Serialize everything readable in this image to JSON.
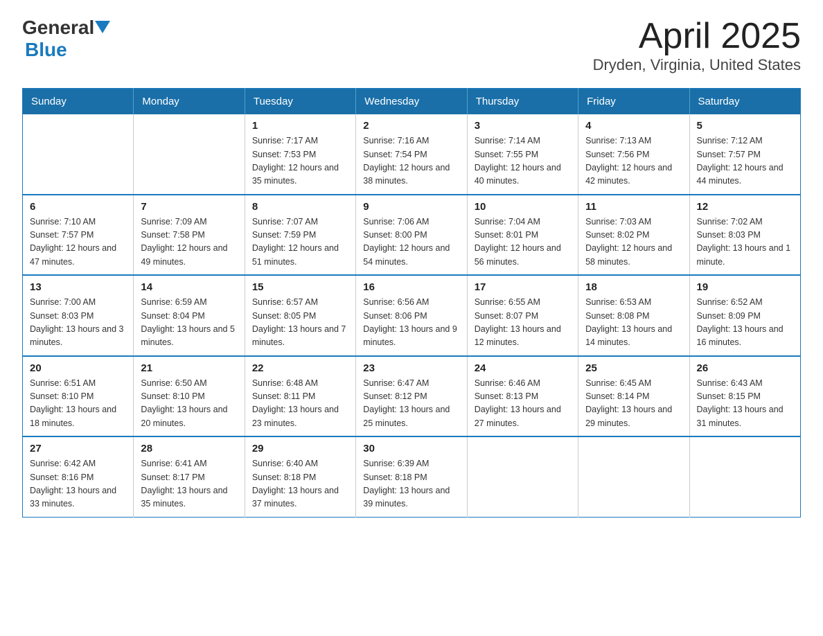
{
  "header": {
    "logo_general": "General",
    "logo_blue": "Blue",
    "title": "April 2025",
    "subtitle": "Dryden, Virginia, United States"
  },
  "weekdays": [
    "Sunday",
    "Monday",
    "Tuesday",
    "Wednesday",
    "Thursday",
    "Friday",
    "Saturday"
  ],
  "weeks": [
    [
      {
        "day": "",
        "sunrise": "",
        "sunset": "",
        "daylight": ""
      },
      {
        "day": "",
        "sunrise": "",
        "sunset": "",
        "daylight": ""
      },
      {
        "day": "1",
        "sunrise": "Sunrise: 7:17 AM",
        "sunset": "Sunset: 7:53 PM",
        "daylight": "Daylight: 12 hours and 35 minutes."
      },
      {
        "day": "2",
        "sunrise": "Sunrise: 7:16 AM",
        "sunset": "Sunset: 7:54 PM",
        "daylight": "Daylight: 12 hours and 38 minutes."
      },
      {
        "day": "3",
        "sunrise": "Sunrise: 7:14 AM",
        "sunset": "Sunset: 7:55 PM",
        "daylight": "Daylight: 12 hours and 40 minutes."
      },
      {
        "day": "4",
        "sunrise": "Sunrise: 7:13 AM",
        "sunset": "Sunset: 7:56 PM",
        "daylight": "Daylight: 12 hours and 42 minutes."
      },
      {
        "day": "5",
        "sunrise": "Sunrise: 7:12 AM",
        "sunset": "Sunset: 7:57 PM",
        "daylight": "Daylight: 12 hours and 44 minutes."
      }
    ],
    [
      {
        "day": "6",
        "sunrise": "Sunrise: 7:10 AM",
        "sunset": "Sunset: 7:57 PM",
        "daylight": "Daylight: 12 hours and 47 minutes."
      },
      {
        "day": "7",
        "sunrise": "Sunrise: 7:09 AM",
        "sunset": "Sunset: 7:58 PM",
        "daylight": "Daylight: 12 hours and 49 minutes."
      },
      {
        "day": "8",
        "sunrise": "Sunrise: 7:07 AM",
        "sunset": "Sunset: 7:59 PM",
        "daylight": "Daylight: 12 hours and 51 minutes."
      },
      {
        "day": "9",
        "sunrise": "Sunrise: 7:06 AM",
        "sunset": "Sunset: 8:00 PM",
        "daylight": "Daylight: 12 hours and 54 minutes."
      },
      {
        "day": "10",
        "sunrise": "Sunrise: 7:04 AM",
        "sunset": "Sunset: 8:01 PM",
        "daylight": "Daylight: 12 hours and 56 minutes."
      },
      {
        "day": "11",
        "sunrise": "Sunrise: 7:03 AM",
        "sunset": "Sunset: 8:02 PM",
        "daylight": "Daylight: 12 hours and 58 minutes."
      },
      {
        "day": "12",
        "sunrise": "Sunrise: 7:02 AM",
        "sunset": "Sunset: 8:03 PM",
        "daylight": "Daylight: 13 hours and 1 minute."
      }
    ],
    [
      {
        "day": "13",
        "sunrise": "Sunrise: 7:00 AM",
        "sunset": "Sunset: 8:03 PM",
        "daylight": "Daylight: 13 hours and 3 minutes."
      },
      {
        "day": "14",
        "sunrise": "Sunrise: 6:59 AM",
        "sunset": "Sunset: 8:04 PM",
        "daylight": "Daylight: 13 hours and 5 minutes."
      },
      {
        "day": "15",
        "sunrise": "Sunrise: 6:57 AM",
        "sunset": "Sunset: 8:05 PM",
        "daylight": "Daylight: 13 hours and 7 minutes."
      },
      {
        "day": "16",
        "sunrise": "Sunrise: 6:56 AM",
        "sunset": "Sunset: 8:06 PM",
        "daylight": "Daylight: 13 hours and 9 minutes."
      },
      {
        "day": "17",
        "sunrise": "Sunrise: 6:55 AM",
        "sunset": "Sunset: 8:07 PM",
        "daylight": "Daylight: 13 hours and 12 minutes."
      },
      {
        "day": "18",
        "sunrise": "Sunrise: 6:53 AM",
        "sunset": "Sunset: 8:08 PM",
        "daylight": "Daylight: 13 hours and 14 minutes."
      },
      {
        "day": "19",
        "sunrise": "Sunrise: 6:52 AM",
        "sunset": "Sunset: 8:09 PM",
        "daylight": "Daylight: 13 hours and 16 minutes."
      }
    ],
    [
      {
        "day": "20",
        "sunrise": "Sunrise: 6:51 AM",
        "sunset": "Sunset: 8:10 PM",
        "daylight": "Daylight: 13 hours and 18 minutes."
      },
      {
        "day": "21",
        "sunrise": "Sunrise: 6:50 AM",
        "sunset": "Sunset: 8:10 PM",
        "daylight": "Daylight: 13 hours and 20 minutes."
      },
      {
        "day": "22",
        "sunrise": "Sunrise: 6:48 AM",
        "sunset": "Sunset: 8:11 PM",
        "daylight": "Daylight: 13 hours and 23 minutes."
      },
      {
        "day": "23",
        "sunrise": "Sunrise: 6:47 AM",
        "sunset": "Sunset: 8:12 PM",
        "daylight": "Daylight: 13 hours and 25 minutes."
      },
      {
        "day": "24",
        "sunrise": "Sunrise: 6:46 AM",
        "sunset": "Sunset: 8:13 PM",
        "daylight": "Daylight: 13 hours and 27 minutes."
      },
      {
        "day": "25",
        "sunrise": "Sunrise: 6:45 AM",
        "sunset": "Sunset: 8:14 PM",
        "daylight": "Daylight: 13 hours and 29 minutes."
      },
      {
        "day": "26",
        "sunrise": "Sunrise: 6:43 AM",
        "sunset": "Sunset: 8:15 PM",
        "daylight": "Daylight: 13 hours and 31 minutes."
      }
    ],
    [
      {
        "day": "27",
        "sunrise": "Sunrise: 6:42 AM",
        "sunset": "Sunset: 8:16 PM",
        "daylight": "Daylight: 13 hours and 33 minutes."
      },
      {
        "day": "28",
        "sunrise": "Sunrise: 6:41 AM",
        "sunset": "Sunset: 8:17 PM",
        "daylight": "Daylight: 13 hours and 35 minutes."
      },
      {
        "day": "29",
        "sunrise": "Sunrise: 6:40 AM",
        "sunset": "Sunset: 8:18 PM",
        "daylight": "Daylight: 13 hours and 37 minutes."
      },
      {
        "day": "30",
        "sunrise": "Sunrise: 6:39 AM",
        "sunset": "Sunset: 8:18 PM",
        "daylight": "Daylight: 13 hours and 39 minutes."
      },
      {
        "day": "",
        "sunrise": "",
        "sunset": "",
        "daylight": ""
      },
      {
        "day": "",
        "sunrise": "",
        "sunset": "",
        "daylight": ""
      },
      {
        "day": "",
        "sunrise": "",
        "sunset": "",
        "daylight": ""
      }
    ]
  ]
}
